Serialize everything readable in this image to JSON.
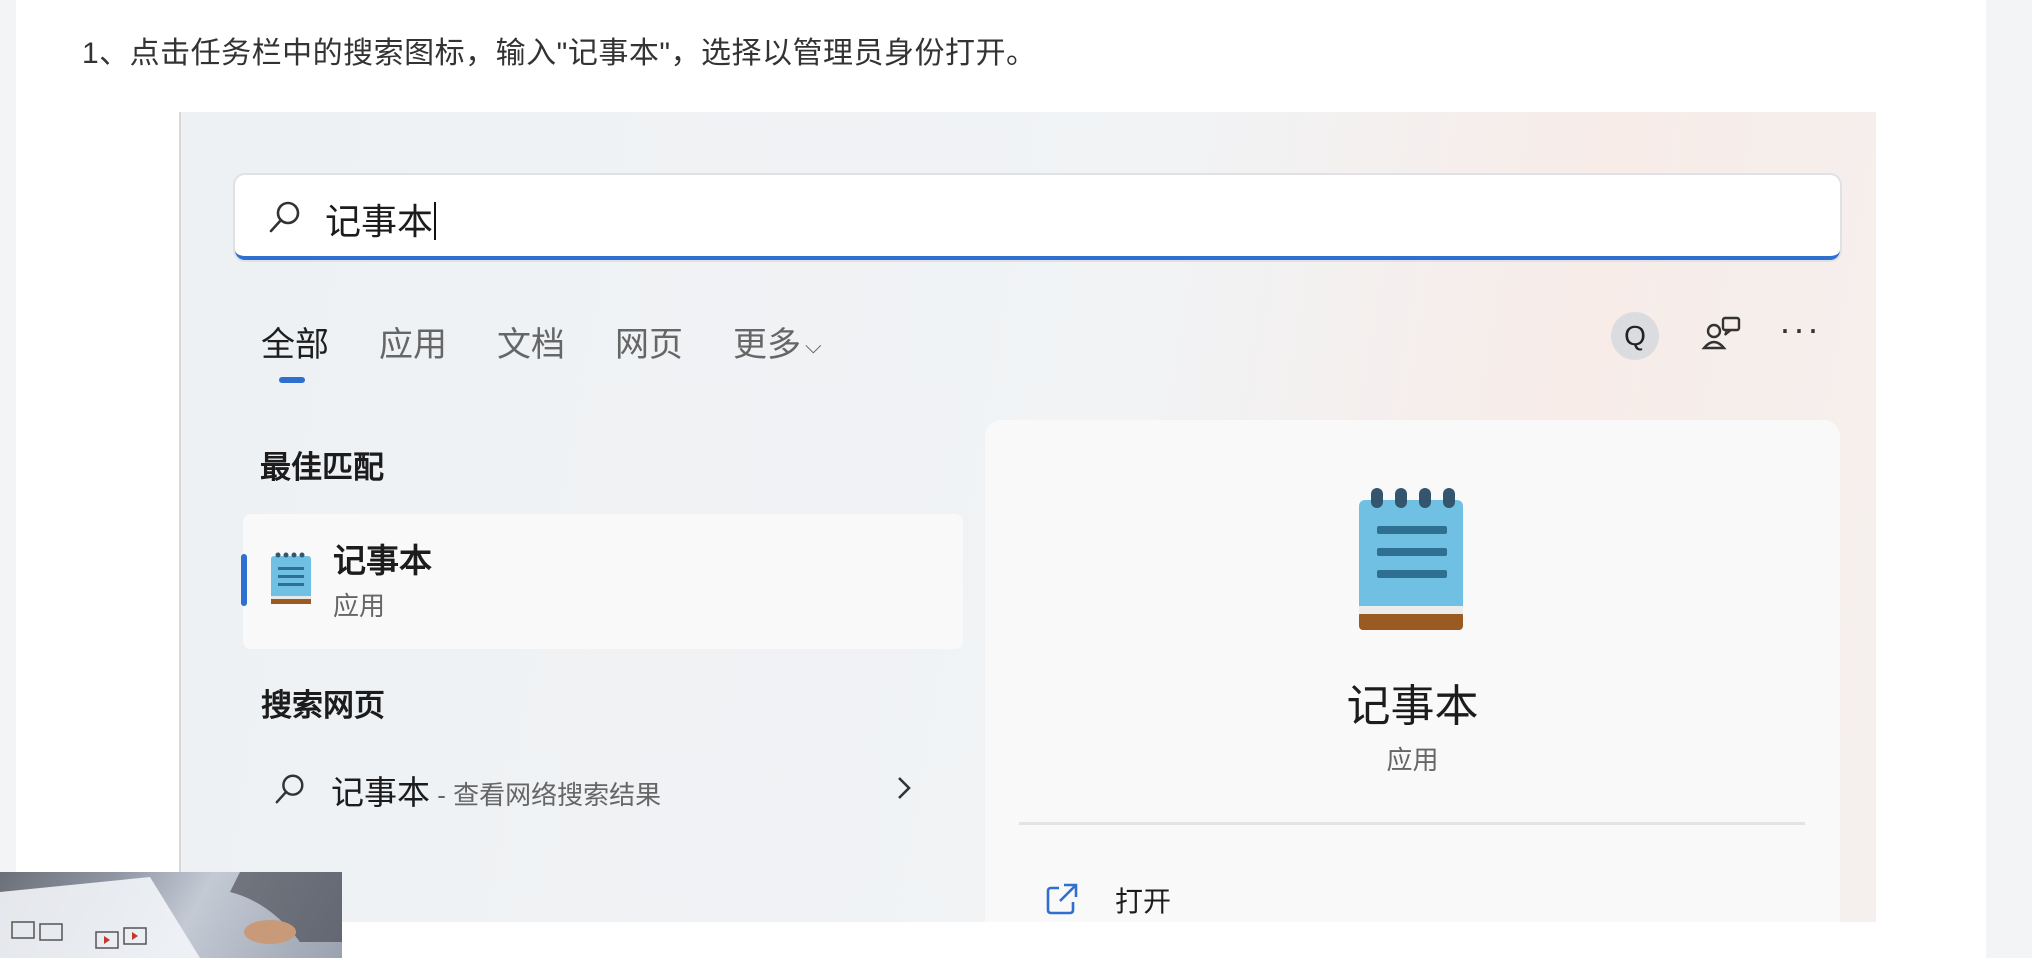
{
  "article": {
    "step1": "1、点击任务栏中的搜索图标，输入\"记事本\"，选择以管理员身份打开。"
  },
  "search": {
    "query": "记事本"
  },
  "tabs": [
    {
      "label": "全部"
    },
    {
      "label": "应用"
    },
    {
      "label": "文档"
    },
    {
      "label": "网页"
    },
    {
      "label": "更多"
    }
  ],
  "toolbar": {
    "q_label": "Q",
    "more_label": "···"
  },
  "best_match": {
    "title": "最佳匹配",
    "name": "记事本",
    "kind": "应用"
  },
  "web_search": {
    "title": "搜索网页",
    "query": "记事本",
    "desc": " - 查看网络搜索结果"
  },
  "detail": {
    "name": "记事本",
    "kind": "应用",
    "action_label": "打开"
  },
  "colors": {
    "accent": "#2f6fd0",
    "notepad_blue": "#6fc0e3",
    "notepad_brown": "#9a5a22"
  }
}
